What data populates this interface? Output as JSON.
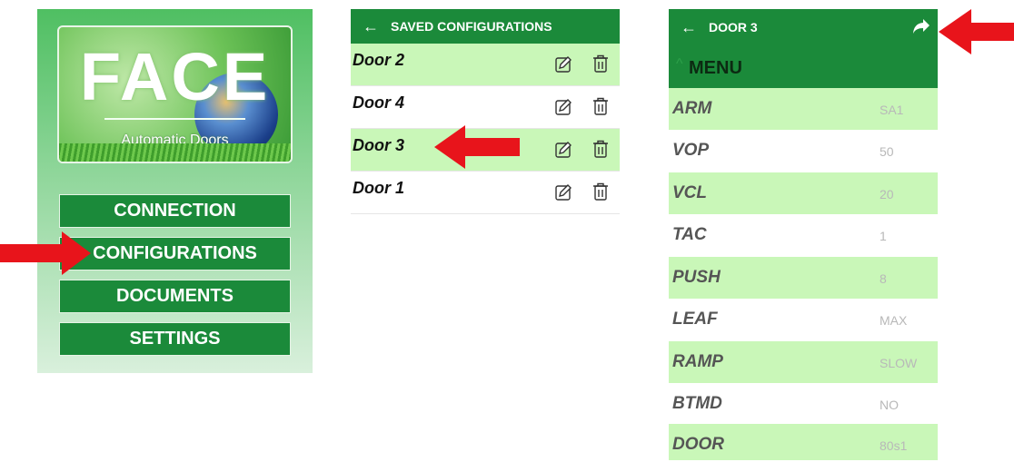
{
  "home": {
    "logo_word": "FACE",
    "logo_tagline": "Automatic Doors",
    "menu": [
      "CONNECTION",
      "CONFIGURATIONS",
      "DOCUMENTS",
      "SETTINGS"
    ]
  },
  "saved": {
    "back_glyph": "←",
    "title": "SAVED CONFIGURATIONS",
    "items": [
      "Door 2",
      "Door 4",
      "Door 3",
      "Door 1"
    ]
  },
  "door": {
    "back_glyph": "←",
    "title": "DOOR 3",
    "menu_chevron": "^",
    "menu_label": "MENU",
    "params": [
      {
        "name": "ARM",
        "value": "SA1"
      },
      {
        "name": "VOP",
        "value": "50"
      },
      {
        "name": "VCL",
        "value": "20"
      },
      {
        "name": "TAC",
        "value": "1"
      },
      {
        "name": "PUSH",
        "value": "8"
      },
      {
        "name": "LEAF",
        "value": "MAX"
      },
      {
        "name": "RAMP",
        "value": "SLOW"
      },
      {
        "name": "BTMD",
        "value": "NO"
      },
      {
        "name": "DOOR",
        "value": "80s1"
      }
    ]
  },
  "icons": {
    "edit": "pencil-edit-icon",
    "delete": "trash-icon",
    "share": "share-arrow-icon",
    "pointer": "red-arrow-icon"
  },
  "colors": {
    "appbar": "#1b8a3a",
    "row_highlight": "#c9f7b8",
    "pointer": "#e8141b"
  }
}
